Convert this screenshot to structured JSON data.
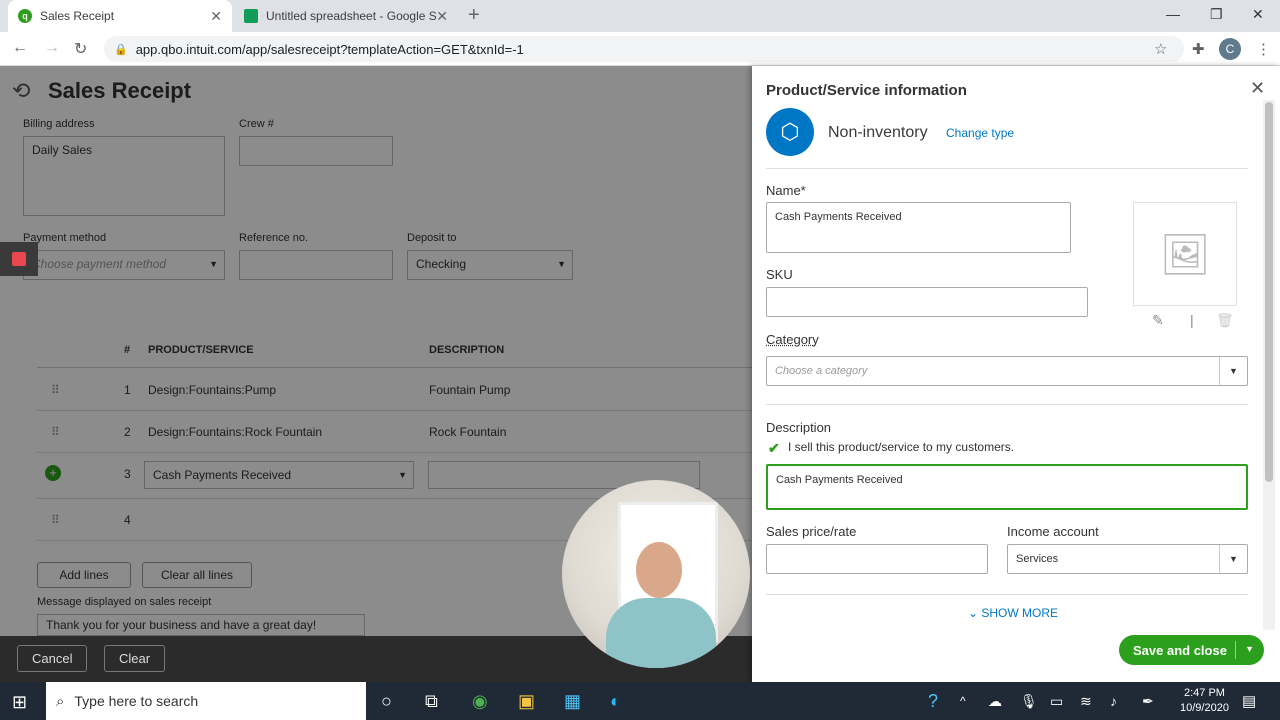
{
  "browser": {
    "tabs": [
      {
        "title": "Sales Receipt",
        "active": true
      },
      {
        "title": "Untitled spreadsheet - Google Sh",
        "active": false
      }
    ],
    "url": "app.qbo.intuit.com/app/salesreceipt?templateAction=GET&txnId=-1",
    "profile_initial": "C"
  },
  "page": {
    "title": "Sales Receipt",
    "billing_address_label": "Billing address",
    "billing_address_value": "Daily Sales",
    "crew_label": "Crew #",
    "payment_method_label": "Payment method",
    "payment_method_placeholder": "Choose payment method",
    "reference_label": "Reference no.",
    "deposit_label": "Deposit to",
    "deposit_value": "Checking",
    "table": {
      "headers": [
        "#",
        "PRODUCT/SERVICE",
        "DESCRIPTION"
      ],
      "rows": [
        {
          "num": "1",
          "product": "Design:Fountains:Pump",
          "description": "Fountain Pump"
        },
        {
          "num": "2",
          "product": "Design:Fountains:Rock Fountain",
          "description": "Rock Fountain"
        },
        {
          "num": "3",
          "product": "Cash Payments Received",
          "description": ""
        },
        {
          "num": "4",
          "product": "",
          "description": ""
        }
      ]
    },
    "add_lines": "Add lines",
    "clear_all_lines": "Clear all lines",
    "message_label": "Message displayed on sales receipt",
    "message_value": "Thank you for your business and have a great day!",
    "footer": {
      "cancel": "Cancel",
      "clear": "Clear"
    }
  },
  "panel": {
    "title": "Product/Service information",
    "type_label": "Non-inventory",
    "change_type": "Change type",
    "name_label": "Name*",
    "name_value": "Cash Payments Received",
    "sku_label": "SKU",
    "category_label": "Category",
    "category_placeholder": "Choose a category",
    "description_label": "Description",
    "sell_check_label": "I sell this product/service to my customers.",
    "description_value": "Cash Payments Received",
    "sales_price_label": "Sales price/rate",
    "income_account_label": "Income account",
    "income_account_value": "Services",
    "show_more": "SHOW MORE",
    "save_and_close": "Save and close"
  },
  "taskbar": {
    "search_placeholder": "Type here to search",
    "time": "2:47 PM",
    "date": "10/9/2020"
  },
  "colors": {
    "accent_green": "#2ca01c",
    "accent_blue": "#0077c5"
  }
}
